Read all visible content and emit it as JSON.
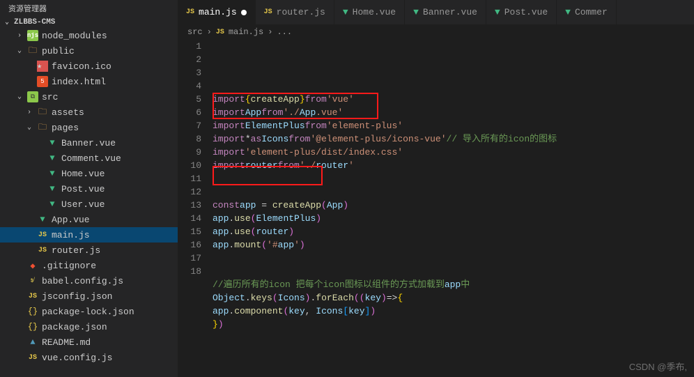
{
  "explorer": {
    "title": "资源管理器",
    "project": "ZLBBS-CMS",
    "tree": [
      {
        "label": "node_modules",
        "icon": "node",
        "indent": 1,
        "chevron": "›"
      },
      {
        "label": "public",
        "icon": "folder",
        "indent": 1,
        "chevron": "⌄"
      },
      {
        "label": "favicon.ico",
        "icon": "favicon",
        "indent": 2
      },
      {
        "label": "index.html",
        "icon": "html",
        "indent": 2
      },
      {
        "label": "src",
        "icon": "src",
        "indent": 1,
        "chevron": "⌄"
      },
      {
        "label": "assets",
        "icon": "folder",
        "indent": 2,
        "chevron": "›"
      },
      {
        "label": "pages",
        "icon": "folder",
        "indent": 2,
        "chevron": "⌄"
      },
      {
        "label": "Banner.vue",
        "icon": "vue",
        "indent": 3
      },
      {
        "label": "Comment.vue",
        "icon": "vue",
        "indent": 3
      },
      {
        "label": "Home.vue",
        "icon": "vue",
        "indent": 3
      },
      {
        "label": "Post.vue",
        "icon": "vue",
        "indent": 3
      },
      {
        "label": "User.vue",
        "icon": "vue",
        "indent": 3
      },
      {
        "label": "App.vue",
        "icon": "vue",
        "indent": 2
      },
      {
        "label": "main.js",
        "icon": "js",
        "indent": 2,
        "active": true
      },
      {
        "label": "router.js",
        "icon": "js",
        "indent": 2
      },
      {
        "label": ".gitignore",
        "icon": "git",
        "indent": 1
      },
      {
        "label": "babel.config.js",
        "icon": "babel",
        "indent": 1
      },
      {
        "label": "jsconfig.json",
        "icon": "js",
        "indent": 1
      },
      {
        "label": "package-lock.json",
        "icon": "json",
        "indent": 1
      },
      {
        "label": "package.json",
        "icon": "json",
        "indent": 1
      },
      {
        "label": "README.md",
        "icon": "md",
        "indent": 1
      },
      {
        "label": "vue.config.js",
        "icon": "js",
        "indent": 1
      }
    ]
  },
  "tabs": [
    {
      "label": "main.js",
      "icon": "js",
      "active": true,
      "modified": true
    },
    {
      "label": "router.js",
      "icon": "js"
    },
    {
      "label": "Home.vue",
      "icon": "vue"
    },
    {
      "label": "Banner.vue",
      "icon": "vue"
    },
    {
      "label": "Post.vue",
      "icon": "vue"
    },
    {
      "label": "Commer",
      "icon": "vue"
    }
  ],
  "breadcrumbs": {
    "parts": [
      "src",
      "main.js",
      "..."
    ],
    "icon": "JS"
  },
  "code": {
    "lines": [
      "import { createApp } from 'vue'",
      "import App from './App.vue'",
      "import ElementPlus from 'element-plus'",
      "import * as Icons from '@element-plus/icons-vue' // 导入所有的icon的图标",
      "import 'element-plus/dist/index.css'",
      "import router from './router'",
      "",
      "",
      "const app = createApp(App)",
      "app.use(ElementPlus)",
      "app.use(router)",
      "app.mount('#app')",
      "",
      "",
      "//遍历所有的icon 把每个icon图标以组件的方式加载到app中",
      "Object.keys(Icons).forEach((key) => {",
      "    app.component(key, Icons[key])",
      "})"
    ]
  },
  "watermark": "CSDN @季布,"
}
